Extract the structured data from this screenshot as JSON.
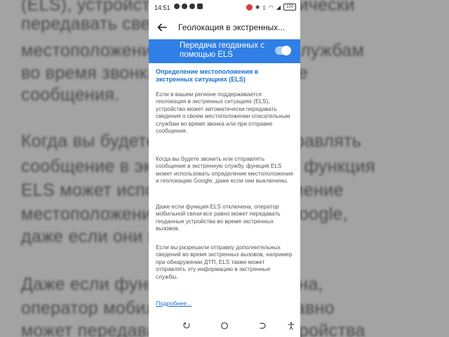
{
  "background": {
    "lines": [
      "(ELS), устройство может автоматически",
      "передавать сведения о своем",
      "местоположении спасательным службам",
      "во время звонка или при отправке",
      "сообщения.",
      "",
      "Когда вы будете звонить или отправлять",
      "сообщение в экстренную службу, функция",
      "ELS может использовать определение",
      "местоположения и геолокацию Google,",
      "даже если они выключены.",
      "",
      "Даже если функция ELS отключена,",
      "оператор мобильной связи все равно",
      "может передавать геоданные устройства"
    ]
  },
  "status_bar": {
    "time": "14:51",
    "battery": "100"
  },
  "app_bar": {
    "title": "Геолокация в экстренных..."
  },
  "toggle": {
    "label": "Передача геоданных с помощью ELS",
    "enabled": true
  },
  "content": {
    "section_title": "Определение местоположения в экстренных ситуациях (ELS)",
    "paragraphs": [
      "Если в вашем регионе поддерживается геолокация в экстренных ситуациях (ELS), устройство может автоматически передавать сведения о своем местоположении спасательным службам во время звонка или при отправке сообщения.",
      "Когда вы будете звонить или отправлять сообщение в экстренную службу, функция ELS может использовать определение местоположения и геолокацию Google, даже если они выключены.",
      "Даже если функция ELS отключена, оператор мобильной связи все равно может передавать геоданные устройства во время экстренных вызовов.",
      "Если вы разрешили отправку дополнительных сведений во время экстренных вызовов, например при обнаружении ДТП, ELS также может отправлять эту информацию в экстренные службы."
    ],
    "more_link": "Подробнее..."
  },
  "icons": {
    "back": "arrow-left-icon",
    "recents": "recents-icon",
    "home": "home-icon",
    "nav_back": "nav-back-icon",
    "accessibility": "accessibility-icon"
  },
  "colors": {
    "accent": "#2f7fe6",
    "link": "#1a6fcf"
  }
}
